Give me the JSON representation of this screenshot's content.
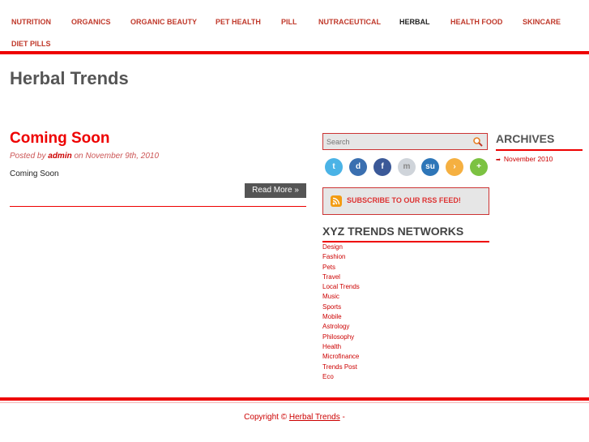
{
  "nav": {
    "items": [
      {
        "label": "NUTRITION",
        "active": false
      },
      {
        "label": "ORGANICS",
        "active": false
      },
      {
        "label": "ORGANIC BEAUTY",
        "active": false
      },
      {
        "label": "PET HEALTH",
        "active": false
      },
      {
        "label": "PILL",
        "active": false
      },
      {
        "label": "NUTRACEUTICAL",
        "active": false
      },
      {
        "label": "HERBAL",
        "active": true
      },
      {
        "label": "HEALTH FOOD",
        "active": false
      },
      {
        "label": "SKINCARE",
        "active": false
      },
      {
        "label": "DIET PILLS",
        "active": false
      }
    ]
  },
  "site": {
    "title": "Herbal Trends"
  },
  "post": {
    "title": "Coming Soon",
    "meta_prefix": "Posted by",
    "author": "admin",
    "meta_suffix": "on November 9th, 2010",
    "body": "Coming Soon",
    "read_more": "Read More »"
  },
  "search": {
    "placeholder": "Search"
  },
  "social": [
    {
      "icon": "twitter-icon",
      "color": "#4ab3e6",
      "glyph": "t"
    },
    {
      "icon": "delicious-icon",
      "color": "#3a6fb0",
      "glyph": "d"
    },
    {
      "icon": "facebook-icon",
      "color": "#3b5998",
      "glyph": "f"
    },
    {
      "icon": "myspace-icon",
      "color": "#cfd4da",
      "glyph": "m"
    },
    {
      "icon": "stumbleupon-icon",
      "color": "#2e76b8",
      "glyph": "su"
    },
    {
      "icon": "share-icon",
      "color": "#f5b041",
      "glyph": "›"
    },
    {
      "icon": "add-icon",
      "color": "#7cc242",
      "glyph": "+"
    }
  ],
  "rss": {
    "label": "SUBSCRIBE TO OUR RSS FEED!"
  },
  "networks": {
    "title": "XYZ TRENDS NETWORKS",
    "items": [
      "Design",
      "Fashion",
      "Pets",
      "Travel",
      "Local Trends",
      "Music",
      "Sports",
      "Mobile",
      "Astrology",
      "Philosophy",
      "Health",
      "Microfinance",
      "Trends Post",
      "Eco"
    ]
  },
  "archives": {
    "title": "ARCHIVES",
    "items": [
      "November 2010"
    ]
  },
  "footer": {
    "prefix": "Copyright ©",
    "link": "Herbal Trends",
    "suffix": "-"
  }
}
